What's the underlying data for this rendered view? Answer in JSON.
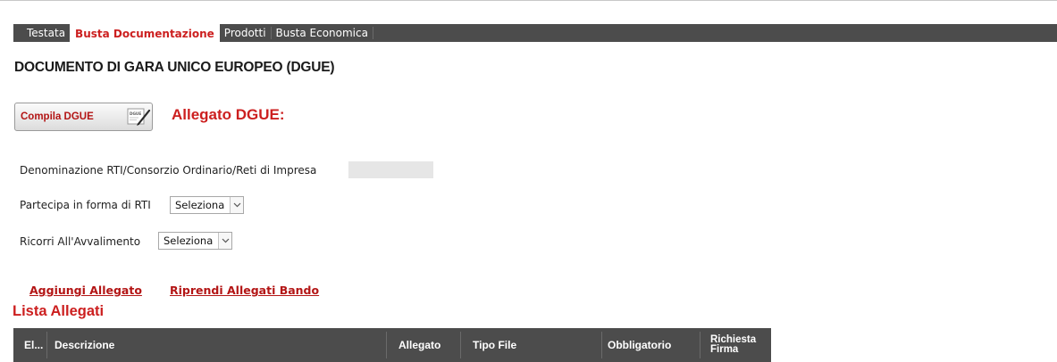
{
  "tabs": [
    {
      "label": "Testata",
      "active": false
    },
    {
      "label": "Busta Documentazione",
      "active": true
    },
    {
      "label": "Prodotti",
      "active": false
    },
    {
      "label": "Busta Economica",
      "active": false
    }
  ],
  "page_title": "DOCUMENTO DI GARA UNICO EUROPEO (DGUE)",
  "dgue": {
    "button_label": "Compila DGUE",
    "icon_text": "DGUE",
    "allegato_label": "Allegato DGUE:"
  },
  "form": {
    "denominazione_label": "Denominazione RTI/Consorzio Ordinario/Reti di Impresa",
    "denominazione_value": "",
    "partecipa_label": "Partecipa in forma di RTI",
    "partecipa_value": "Seleziona",
    "ricorri_label": "Ricorri All'Avvalimento",
    "ricorri_value": "Seleziona"
  },
  "links": {
    "aggiungi": "Aggiungi Allegato",
    "riprendi": "Riprendi Allegati Bando"
  },
  "lista": {
    "title": "Lista Allegati",
    "columns": [
      "El...",
      "Descrizione",
      "Allegato",
      "Tipo File",
      "Obbligatorio",
      "Richiesta",
      "Firma"
    ]
  },
  "colors": {
    "accent": "#cc1f1f",
    "bar": "#4c4c4c"
  }
}
